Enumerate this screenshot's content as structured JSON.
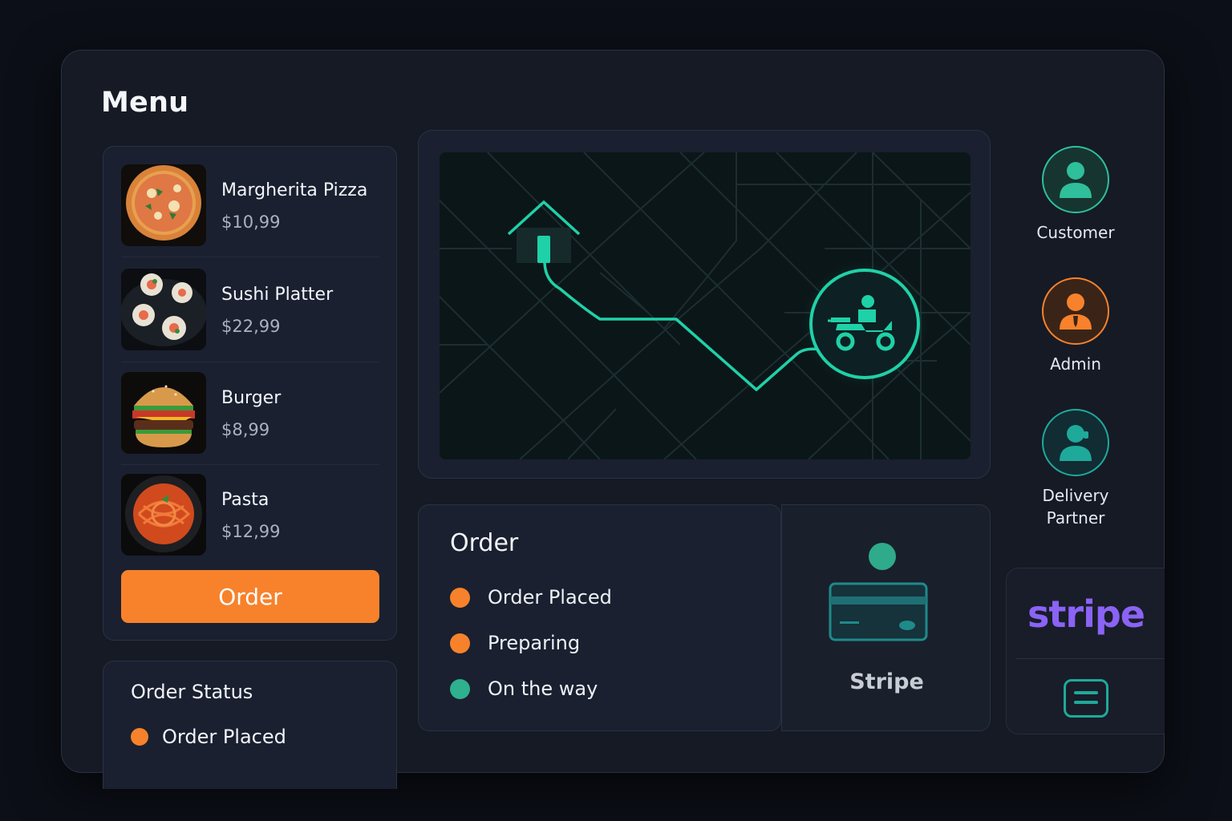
{
  "menu": {
    "title": "Menu",
    "items": [
      {
        "name": "Margherita Pizza",
        "price": "$10,99",
        "icon": "pizza-image"
      },
      {
        "name": "Sushi Platter",
        "price": "$22,99",
        "icon": "sushi-image"
      },
      {
        "name": "Burger",
        "price": "$8,99",
        "icon": "burger-image"
      },
      {
        "name": "Pasta",
        "price": "$12,99",
        "icon": "pasta-image"
      }
    ],
    "order_button": "Order"
  },
  "order_status": {
    "title": "Order Status",
    "items": [
      {
        "label": "Order Placed",
        "color": "#f7822b"
      }
    ]
  },
  "map": {
    "icons": [
      "home-icon",
      "delivery-scooter-icon"
    ],
    "accent": "#1fd1a8"
  },
  "order": {
    "title": "Order",
    "steps": [
      {
        "label": "Order Placed",
        "color": "#f7822b"
      },
      {
        "label": "Preparing",
        "color": "#f7822b"
      },
      {
        "label": "On the way",
        "color": "#2fb08f"
      }
    ]
  },
  "payment": {
    "label": "Stripe",
    "icon": "credit-card-icon"
  },
  "roles": [
    {
      "label": "Customer",
      "color": "#2fbf9a"
    },
    {
      "label": "Admin",
      "color": "#f7822b"
    },
    {
      "label": "Delivery Partner",
      "color": "#1fa99a"
    }
  ],
  "brand": {
    "logo_text": "stripe",
    "logo_color": "#8b63f5",
    "icon": "card-icon"
  }
}
